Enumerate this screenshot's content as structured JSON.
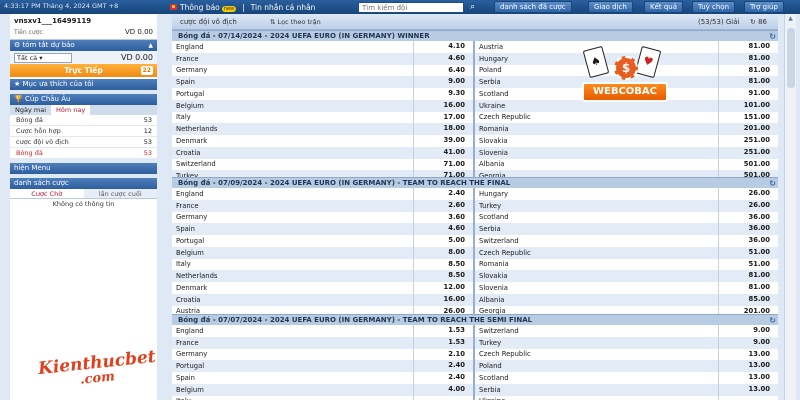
{
  "topbar": {
    "clock": "4:33:17 PM Tháng 4, 2024 GMT +8",
    "nav": [
      {
        "label": "Thông báo",
        "badge": "new"
      },
      {
        "label": "Tin nhắn cá nhân"
      }
    ],
    "search_placeholder": "Tìm kiếm đội",
    "buttons": [
      "danh sách đã cược",
      "Giao dịch",
      "Kết quả",
      "Tuỳ chọn",
      "Trợ giúp"
    ]
  },
  "account": {
    "username": "vnsxv1___16499119",
    "balance_label": "Tiền cược",
    "balance_value": "VD 0.00"
  },
  "sidebar": {
    "summary_title": "tóm tắt dự báo",
    "summary_select": "Tất cả",
    "summary_value": "VD 0.00",
    "live_label": "Trực Tiếp",
    "live_count": "22",
    "favorites_title": "Mục ưa thích của tôi",
    "cup_title": "Cúp Châu Âu",
    "tabs": [
      "Ngày mai",
      "Hôm nay"
    ],
    "sports": [
      {
        "label": "Bóng đá",
        "count": "53"
      },
      {
        "label": "Cược hỗn hợp",
        "count": "12"
      },
      {
        "label": "cược đội vô địch",
        "count": "53"
      },
      {
        "label": "Bóng đá",
        "count": "53",
        "active": true
      }
    ],
    "menu_title": "hiện Menu",
    "bets_title": "danh sách cược",
    "bet_tabs": [
      "Cược Chờ",
      "lần cược cuối"
    ],
    "empty_text": "Không có thông tin"
  },
  "logos": {
    "kienthuc_top": "Kienthucbet",
    "kienthuc_bottom": ".com",
    "webcobac": "WEBCOBAC"
  },
  "icons": {
    "flag": "vietnam-flag-icon",
    "search": "search-icon",
    "refresh": "refresh-icon",
    "filter": "filter-icon",
    "chip": "casino-chip-icon",
    "cards": "playing-cards-icon",
    "star": "star-icon",
    "trophy": "trophy-icon"
  },
  "main": {
    "header": {
      "title": "cược đội vô địch",
      "filter": "Lọc theo trận",
      "status": "(53/53) Giải",
      "count": "86"
    },
    "markets": [
      {
        "title": "Bóng đá - 07/14/2024 - 2024 UEFA EURO (IN GERMANY) WINNER",
        "rows": [
          [
            [
              "England",
              "4.10"
            ],
            [
              "Austria",
              "81.00"
            ]
          ],
          [
            [
              "France",
              "4.60"
            ],
            [
              "Hungary",
              "81.00"
            ]
          ],
          [
            [
              "Germany",
              "6.40"
            ],
            [
              "Poland",
              "81.00"
            ]
          ],
          [
            [
              "Spain",
              "9.00"
            ],
            [
              "Serbia",
              "81.00"
            ]
          ],
          [
            [
              "Portugal",
              "9.30"
            ],
            [
              "Scotland",
              "91.00"
            ]
          ],
          [
            [
              "Belgium",
              "16.00"
            ],
            [
              "Ukraine",
              "101.00"
            ]
          ],
          [
            [
              "Italy",
              "17.00"
            ],
            [
              "Czech Republic",
              "151.00"
            ]
          ],
          [
            [
              "Netherlands",
              "18.00"
            ],
            [
              "Romania",
              "201.00"
            ]
          ],
          [
            [
              "Denmark",
              "39.00"
            ],
            [
              "Slovakia",
              "251.00"
            ]
          ],
          [
            [
              "Croatia",
              "41.00"
            ],
            [
              "Slovenia",
              "251.00"
            ]
          ],
          [
            [
              "Switzerland",
              "71.00"
            ],
            [
              "Albania",
              "501.00"
            ]
          ],
          [
            [
              "Turkey",
              "71.00"
            ],
            [
              "Georgia",
              "501.00"
            ]
          ]
        ]
      },
      {
        "title": "Bóng đá - 07/09/2024 - 2024 UEFA EURO (IN GERMANY) - TEAM TO REACH THE FINAL",
        "rows": [
          [
            [
              "England",
              "2.40"
            ],
            [
              "Hungary",
              "26.00"
            ]
          ],
          [
            [
              "France",
              "2.60"
            ],
            [
              "Turkey",
              "26.00"
            ]
          ],
          [
            [
              "Germany",
              "3.60"
            ],
            [
              "Scotland",
              "36.00"
            ]
          ],
          [
            [
              "Spain",
              "4.60"
            ],
            [
              "Serbia",
              "36.00"
            ]
          ],
          [
            [
              "Portugal",
              "5.00"
            ],
            [
              "Switzerland",
              "36.00"
            ]
          ],
          [
            [
              "Belgium",
              "8.00"
            ],
            [
              "Czech Republic",
              "51.00"
            ]
          ],
          [
            [
              "Italy",
              "8.50"
            ],
            [
              "Romania",
              "51.00"
            ]
          ],
          [
            [
              "Netherlands",
              "8.50"
            ],
            [
              "Slovakia",
              "81.00"
            ]
          ],
          [
            [
              "Denmark",
              "12.00"
            ],
            [
              "Slovenia",
              "81.00"
            ]
          ],
          [
            [
              "Croatia",
              "16.00"
            ],
            [
              "Albania",
              "85.00"
            ]
          ],
          [
            [
              "Austria",
              "26.00"
            ],
            [
              "Georgia",
              "201.00"
            ]
          ]
        ]
      },
      {
        "title": "Bóng đá - 07/07/2024 - 2024 UEFA EURO (IN GERMANY) - TEAM TO REACH THE SEMI FINAL",
        "rows": [
          [
            [
              "England",
              "1.53"
            ],
            [
              "Switzerland",
              "9.00"
            ]
          ],
          [
            [
              "France",
              "1.53"
            ],
            [
              "Turkey",
              "9.00"
            ]
          ],
          [
            [
              "Germany",
              "2.10"
            ],
            [
              "Czech Republic",
              "13.00"
            ]
          ],
          [
            [
              "Portugal",
              "2.40"
            ],
            [
              "Poland",
              "13.00"
            ]
          ],
          [
            [
              "Spain",
              "2.40"
            ],
            [
              "Scotland",
              "13.00"
            ]
          ],
          [
            [
              "Belgium",
              "4.00"
            ],
            [
              "Serbia",
              "13.00"
            ]
          ],
          [
            [
              "Italy",
              ""
            ],
            [
              "Ukraine",
              ""
            ]
          ]
        ]
      }
    ]
  }
}
